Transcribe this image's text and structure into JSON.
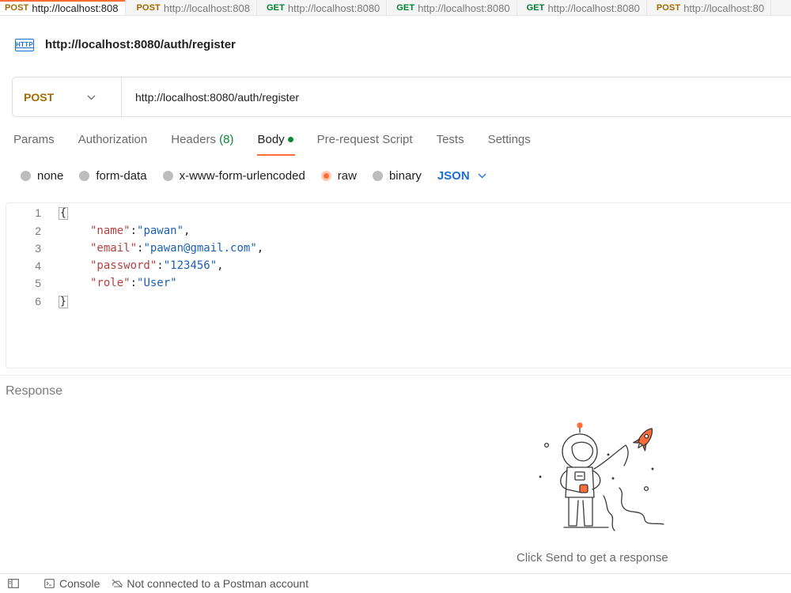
{
  "tabs": [
    {
      "method": "POST",
      "url": "http://localhost:808",
      "active": true
    },
    {
      "method": "POST",
      "url": "http://localhost:808",
      "active": false
    },
    {
      "method": "GET",
      "url": "http://localhost:8080",
      "active": false
    },
    {
      "method": "GET",
      "url": "http://localhost:8080",
      "active": false
    },
    {
      "method": "GET",
      "url": "http://localhost:8080",
      "active": false
    },
    {
      "method": "POST",
      "url": "http://localhost:80",
      "active": false
    }
  ],
  "request": {
    "icon_label": "HTTP",
    "title": "http://localhost:8080/auth/register",
    "method": "POST",
    "url": "http://localhost:8080/auth/register"
  },
  "subtabs": {
    "params": "Params",
    "authorization": "Authorization",
    "headers": "Headers",
    "headers_count": "(8)",
    "body": "Body",
    "prerequest": "Pre-request Script",
    "tests": "Tests",
    "settings": "Settings"
  },
  "body_types": {
    "none": "none",
    "form_data": "form-data",
    "urlencoded": "x-www-form-urlencoded",
    "raw": "raw",
    "binary": "binary",
    "language": "JSON"
  },
  "editor": {
    "line_numbers": [
      "1",
      "2",
      "3",
      "4",
      "5",
      "6"
    ],
    "open_brace": "{",
    "close_brace": "}",
    "fields": [
      {
        "key": "\"name\"",
        "value": "\"pawan\"",
        "trail": ","
      },
      {
        "key": "\"email\"",
        "value": "\"pawan@gmail.com\"",
        "trail": ","
      },
      {
        "key": "\"password\"",
        "value": "\"123456\"",
        "trail": ","
      },
      {
        "key": "\"role\"",
        "value": "\"User\"",
        "trail": ""
      }
    ]
  },
  "response": {
    "title": "Response",
    "hint": "Click Send to get a response"
  },
  "statusbar": {
    "console": "Console",
    "connection": "Not connected to a Postman account"
  },
  "colors": {
    "accent": "#ff6c37",
    "post": "#a26a00",
    "get": "#007f31",
    "link": "#1c6ed6"
  }
}
